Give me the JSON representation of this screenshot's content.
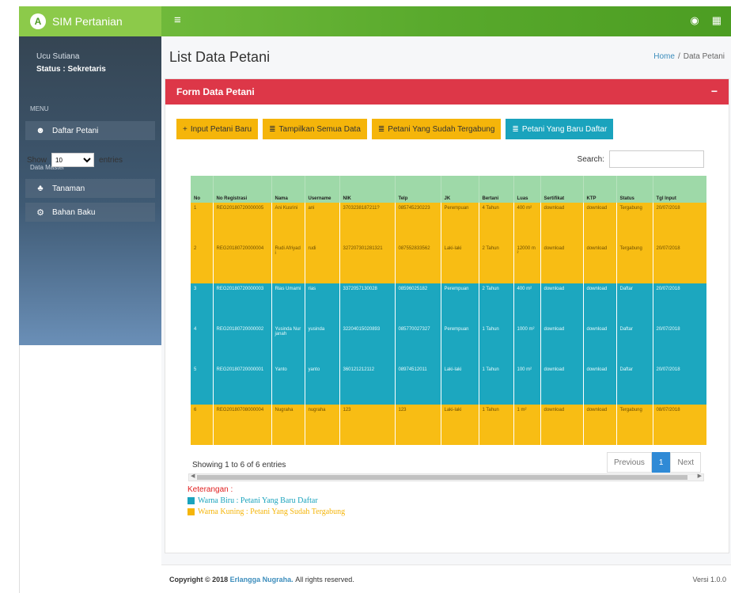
{
  "app": {
    "brand": "SIM Pertanian",
    "logo_letter": "A"
  },
  "topbar": {
    "toggle_icon": "≡",
    "icons": [
      "user-icon",
      "grid-icon"
    ]
  },
  "sidebar": {
    "user_name": "Ucu Sutiana",
    "user_status": "Status : Sekretaris",
    "menu_header": "MENU",
    "data_master_header": "Data Master",
    "items": [
      {
        "label": "Daftar Petani",
        "icon": "users-icon"
      },
      {
        "label": "Tanaman",
        "icon": "plant-icon"
      },
      {
        "label": "Bahan Baku",
        "icon": "cogs-icon"
      }
    ]
  },
  "page": {
    "title": "List Data Petani",
    "breadcrumb": [
      "Home",
      "/",
      "Data Petani"
    ]
  },
  "card": {
    "header": "Form Data Petani",
    "collapse": "−",
    "buttons": [
      {
        "label": "Input Petani Baru",
        "icon": "+",
        "color": "#f5b50a"
      },
      {
        "label": "Tampilkan Semua Data",
        "icon": "≣",
        "color": "#f5b50a"
      },
      {
        "label": "Petani Yang Sudah Tergabung",
        "icon": "≣",
        "color": "#f5b50a"
      },
      {
        "label": "Petani Yang Baru Daftar",
        "icon": "≣",
        "color": "#1aa3bd"
      }
    ],
    "show_label": "Show",
    "entries_label": "entries",
    "entries_value": "10",
    "search_label": "Search:",
    "search_value": ""
  },
  "table": {
    "headers": [
      "No",
      "No Registrasi",
      "Nama",
      "Username",
      "NIK",
      "Telp",
      "JK",
      "Bertani",
      "Luas",
      "Sertifikat",
      "KTP",
      "Status",
      "Tgl Input"
    ],
    "rows": [
      {
        "style": "yellow",
        "cells": [
          "1",
          "REG20180720000005",
          "Ani Kusrini",
          "ani",
          "3703238187211?",
          "085745230223",
          "Perempuan",
          "4 Tahun",
          "400 m²",
          "download",
          "download",
          "Tergabung",
          "20/07/2018"
        ]
      },
      {
        "style": "yellow",
        "cells": [
          "2",
          "REG20180720000004",
          "Rudi Afriyadi",
          "rudi",
          "327207301281321",
          "087552833562",
          "Laki-laki",
          "2 Tahun",
          "12000 m²",
          "download",
          "download",
          "Tergabung",
          "20/07/2018"
        ]
      },
      {
        "style": "teal",
        "cells": [
          "3",
          "REG20180720000003",
          "Rias Umami",
          "rias",
          "3372057130028",
          "08596025182",
          "Perempuan",
          "2 Tahun",
          "400 m²",
          "download",
          "download",
          "Daftar",
          "20/07/2018"
        ]
      },
      {
        "style": "teal",
        "cells": [
          "4",
          "REG20180720000002",
          "Yusinda Nurjanah",
          "yusinda",
          "32204015020893",
          "085770027327",
          "Perempuan",
          "1 Tahun",
          "1000 m²",
          "download",
          "download",
          "Daftar",
          "20/07/2018"
        ]
      },
      {
        "style": "teal",
        "cells": [
          "5",
          "REG20180720000001",
          "Yanto",
          "yanto",
          "360121212112",
          "08974512011",
          "Laki-laki",
          "1 Tahun",
          "100 m²",
          "download",
          "download",
          "Daftar",
          "20/07/2018"
        ]
      },
      {
        "style": "yellow",
        "cells": [
          "6",
          "REG20180708000004",
          "Nugraha",
          "nugraha",
          "123",
          "123",
          "Laki-laki",
          "1 Tahun",
          "1 m²",
          "download",
          "download",
          "Tergabung",
          "08/07/2018"
        ]
      }
    ],
    "showing": "Showing 1 to 6 of 6 entries",
    "pagination": [
      "Previous",
      "1",
      "Next"
    ]
  },
  "legend": {
    "title": "Keterangan :",
    "items": [
      {
        "label": "Warna Biru : Petani Yang Baru Daftar",
        "color": "#1aa3bd"
      },
      {
        "label": "Warna Kuning : Petani Yang Sudah Tergabung",
        "color": "#f5b50a"
      }
    ]
  },
  "footer": {
    "copyright": "Copyright © 2018",
    "author": "Erlangga Nugraha.",
    "rights": "All rights reserved.",
    "version": "Versi 1.0.0"
  }
}
